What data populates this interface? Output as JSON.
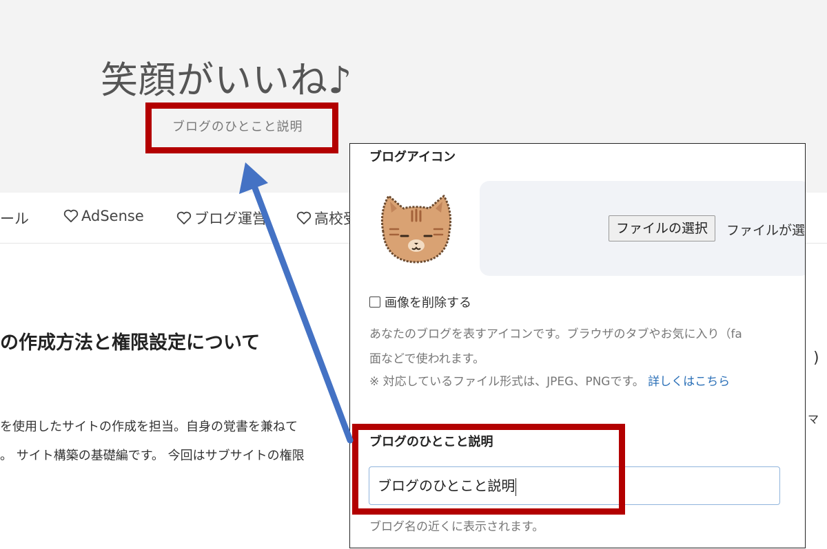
{
  "header": {
    "title": "笑顔がいいね♪",
    "description": "ブログのひとこと説明"
  },
  "nav": {
    "items": [
      {
        "label": "ール",
        "heart": false
      },
      {
        "label": "AdSense",
        "heart": true
      },
      {
        "label": "ブログ運営",
        "heart": true
      },
      {
        "label": "高校受",
        "heart": true
      }
    ]
  },
  "article": {
    "title": "の作成方法と権限設定について",
    "line1": "を使用したサイトの作成を担当。自身の覚書を兼ねて",
    "line2": "。 サイト構築の基礎編です。 今回はサブサイトの権限",
    "edge_right_1": ")",
    "edge_right_2": "マ"
  },
  "settings": {
    "icon_heading": "ブログアイコン",
    "file_button": "ファイルの選択",
    "file_status": "ファイルが選",
    "delete_checkbox_label": "画像を削除する",
    "icon_help_line1": "あなたのブログを表すアイコンです。ブラウザのタブやお気に入り（fa",
    "icon_help_line2": "面などで使われます。",
    "icon_help_line3": "※ 対応しているファイル形式は、JPEG、PNGです。",
    "icon_help_link": "詳しくはこちら",
    "desc_heading": "ブログのひとこと説明",
    "desc_value": "ブログのひとこと説明",
    "desc_help": "ブログ名の近くに表示されます。"
  },
  "colors": {
    "highlight_box": "#b30000",
    "arrow": "#4472c4",
    "link": "#2a6fb7"
  }
}
